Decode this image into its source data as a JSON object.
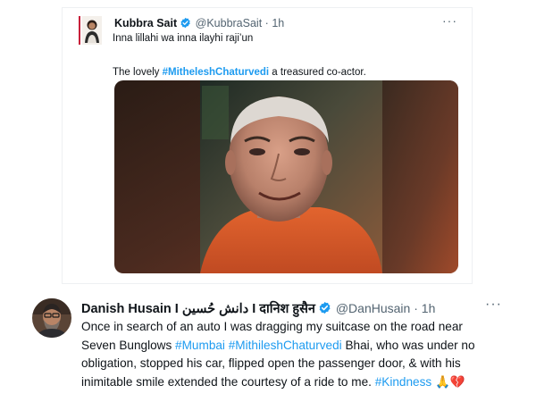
{
  "tweet1": {
    "author_name": "Kubbra Sait",
    "handle": "@KubbraSait",
    "separator": "·",
    "time": "1h",
    "more": "···",
    "text_line1": "Inna lillahi wa inna ilayhi raji’un",
    "text_line2_prefix": "The lovely ",
    "text_line2_hashtag": "#MitheleshChaturvedi",
    "text_line2_suffix": " a treasured co-actor."
  },
  "tweet2": {
    "author_name": "Danish Husain I دانش حُسین I दानिश हुसैन",
    "handle": "@DanHusain",
    "separator": "·",
    "time": "1h",
    "more": "···",
    "line1": "Once in search of an auto I was dragging my suitcase on the road near",
    "line2_prefix": "Seven Bunglows ",
    "line2_hashtag1": "#Mumbai",
    "line2_space": " ",
    "line2_hashtag2": "#MithileshChaturvedi",
    "line2_suffix": " Bhai, who was under no",
    "line3": "obligation, stopped his car, flipped open the passenger door, & with his",
    "line4_prefix": "inimitable smile extended the courtesy of a ride to me. ",
    "line4_hashtag": "#Kindness",
    "emoji1": "🙏",
    "emoji2": "💔"
  },
  "colors": {
    "link": "#1d9bf0",
    "verified": "#1d9bf0",
    "secondary_text": "#536471"
  },
  "icons": [
    "verified-badge-icon",
    "more-options-icon"
  ]
}
